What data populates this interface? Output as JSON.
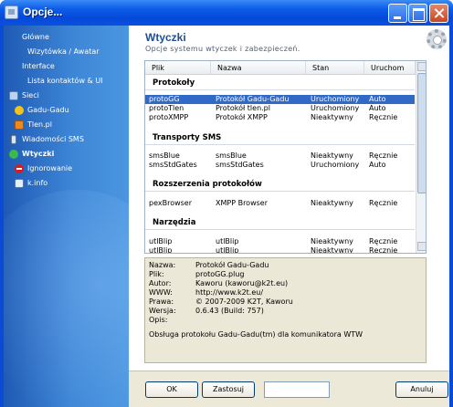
{
  "window": {
    "title": "Opcje..."
  },
  "sidebar": {
    "items": [
      {
        "label": "Główne"
      },
      {
        "label": "Wizytówka / Awatar"
      },
      {
        "label": "Interface"
      },
      {
        "label": "Lista kontaktów & UI"
      },
      {
        "label": "Sieci",
        "icon": "network-icon"
      },
      {
        "label": "Gadu-Gadu",
        "icon": "gadu-gadu-icon"
      },
      {
        "label": "Tlen.pl",
        "icon": "tlen-icon"
      },
      {
        "label": "Wiadomości SMS",
        "icon": "phone-icon"
      },
      {
        "label": "Wtyczki",
        "icon": "plugin-icon",
        "active": true
      },
      {
        "label": "Ignorowanie",
        "icon": "block-icon"
      },
      {
        "label": "k.info",
        "icon": "info-icon"
      }
    ]
  },
  "main": {
    "title": "Wtyczki",
    "subtitle": "Opcje systemu wtyczek i zabezpieczeń."
  },
  "list": {
    "columns": [
      "Plik",
      "Nazwa",
      "Stan",
      "Uruchom"
    ],
    "groups": [
      {
        "name": "Protokoły",
        "rows": [
          {
            "file": "protoGG",
            "name": "Protokół Gadu-Gadu",
            "state": "Uruchomiony",
            "run": "Auto",
            "selected": true
          },
          {
            "file": "protoTlen",
            "name": "Protokół tlen.pl",
            "state": "Uruchomiony",
            "run": "Auto"
          },
          {
            "file": "protoXMPP",
            "name": "Protokół XMPP",
            "state": "Nieaktywny",
            "run": "Ręcznie"
          }
        ]
      },
      {
        "name": "Transporty SMS",
        "rows": [
          {
            "file": "smsBlue",
            "name": "smsBlue",
            "state": "Nieaktywny",
            "run": "Ręcznie"
          },
          {
            "file": "smsStdGates",
            "name": "smsStdGates",
            "state": "Uruchomiony",
            "run": "Auto"
          }
        ]
      },
      {
        "name": "Rozszerzenia protokołów",
        "rows": [
          {
            "file": "pexBrowser",
            "name": "XMPP Browser",
            "state": "Nieaktywny",
            "run": "Ręcznie"
          }
        ]
      },
      {
        "name": "Narzędzia",
        "rows": [
          {
            "file": "utlBlip",
            "name": "utlBlip",
            "state": "Nieaktywny",
            "run": "Ręcznie"
          },
          {
            "file": "utlBlip",
            "name": "utlBlip",
            "state": "Nieaktywny",
            "run": "Ręcznie"
          }
        ]
      }
    ]
  },
  "details": {
    "rows": [
      {
        "label": "Nazwa:",
        "value": "Protokół Gadu-Gadu"
      },
      {
        "label": "Plik:",
        "value": "protoGG.plug"
      },
      {
        "label": "Autor:",
        "value": "Kaworu (kaworu@k2t.eu)"
      },
      {
        "label": "WWW:",
        "value": "http://www.k2t.eu/"
      },
      {
        "label": "Prawa:",
        "value": "© 2007-2009 K2T, Kaworu"
      },
      {
        "label": "Wersja:",
        "value": "0.6.43 (Build: 757)"
      },
      {
        "label": "Opis:",
        "value": ""
      }
    ],
    "description": "Obsługa protokołu Gadu-Gadu(tm) dla komunikatora WTW"
  },
  "buttons": {
    "ok": "OK",
    "apply": "Zastosuj",
    "cancel": "Anuluj"
  }
}
